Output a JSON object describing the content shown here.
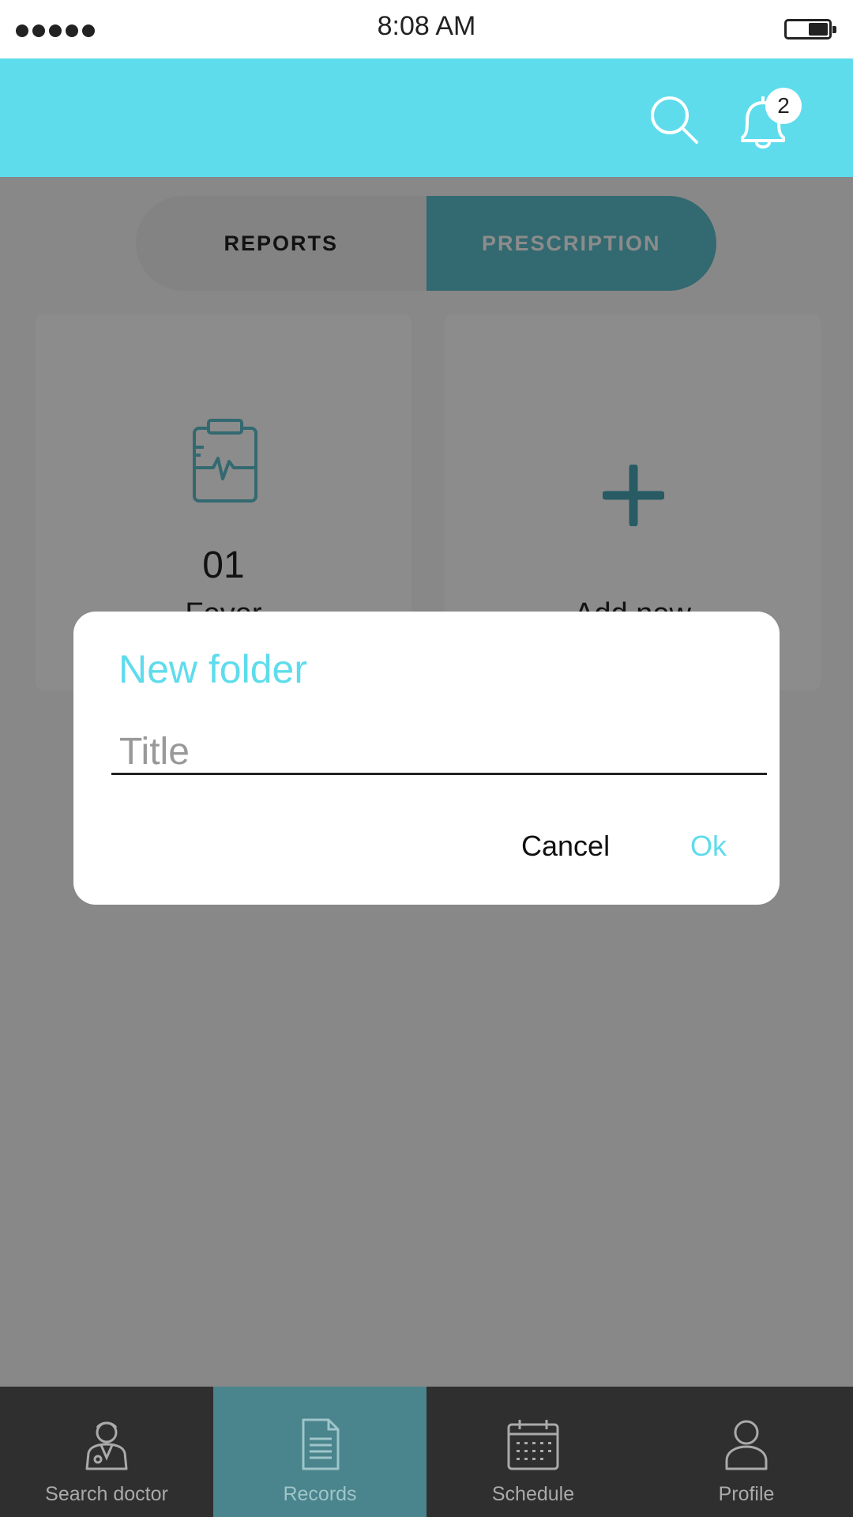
{
  "status_bar": {
    "time": "8:08 AM"
  },
  "header": {
    "notification_count": "2",
    "icons": [
      "search-icon",
      "bell-icon"
    ],
    "background_color": "#5edcec"
  },
  "tabs": [
    {
      "label": "REPORTS",
      "selected": false
    },
    {
      "label": "PRESCRIPTION",
      "selected": true
    }
  ],
  "folders": [
    {
      "number": "01",
      "label": "Fever",
      "icon": "clipboard-pulse-icon"
    },
    {
      "label": "Add new",
      "icon": "plus-icon"
    }
  ],
  "dialog": {
    "title": "New folder",
    "input_placeholder": "Title",
    "input_value": "",
    "cancel_label": "Cancel",
    "ok_label": "Ok"
  },
  "bottom_nav": [
    {
      "label": "Search doctor",
      "icon": "doctor-icon",
      "active": false
    },
    {
      "label": "Records",
      "icon": "document-icon",
      "active": true
    },
    {
      "label": "Schedule",
      "icon": "calendar-icon",
      "active": false
    },
    {
      "label": "Profile",
      "icon": "person-icon",
      "active": false
    }
  ],
  "colors": {
    "accent": "#5edcec",
    "tab_active": "#5ec0cc",
    "nav_background": "#2f2f2f",
    "nav_active": "#4a848c"
  }
}
